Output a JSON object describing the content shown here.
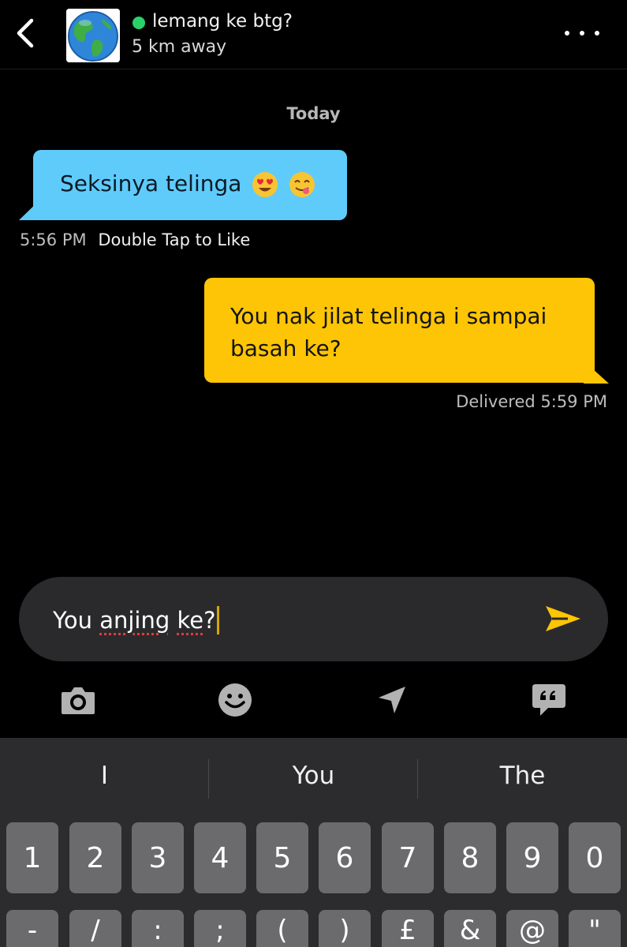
{
  "header": {
    "contact_name": "lemang ke btg?",
    "distance": "5 km away",
    "online_color": "#2ad16a"
  },
  "messages": {
    "day_label": "Today",
    "incoming": {
      "text": "Seksinya telinga",
      "emojis": [
        "heart-eyes-emoji",
        "yum-emoji"
      ],
      "time": "5:56 PM",
      "hint": "Double Tap to Like",
      "color": "#5fcbfb"
    },
    "outgoing": {
      "text": "You nak jilat telinga i sampai basah ke?",
      "status": "Delivered 5:59 PM",
      "color": "#fdc505"
    }
  },
  "composer": {
    "text_plain": "You ",
    "text_misspelled_1": "anjing",
    "text_space": " ",
    "text_misspelled_2": "ke",
    "text_end": "?"
  },
  "toolbar": [
    "camera-icon",
    "smiley-icon",
    "location-icon",
    "quote-bubble-icon"
  ],
  "keyboard": {
    "suggestions": [
      "I",
      "You",
      "The"
    ],
    "number_row": [
      "1",
      "2",
      "3",
      "4",
      "5",
      "6",
      "7",
      "8",
      "9",
      "0"
    ],
    "symbol_row": [
      "-",
      "/",
      ":",
      ";",
      "(",
      ")",
      "£",
      "&",
      "@",
      "\""
    ]
  }
}
